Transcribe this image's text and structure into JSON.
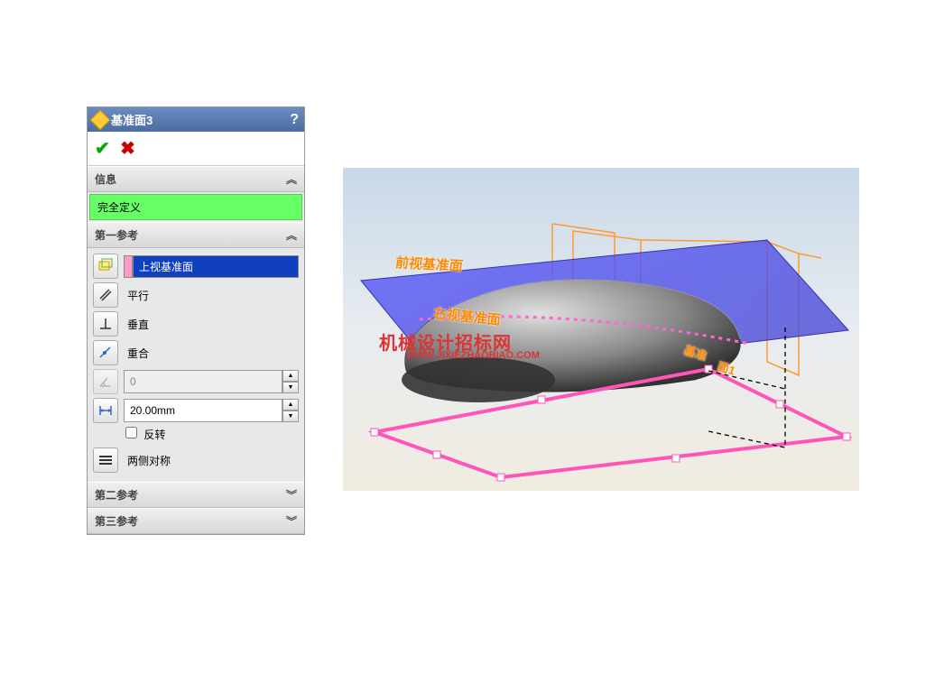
{
  "feature": {
    "title": "基准面3",
    "help": "?"
  },
  "actions": {
    "ok": "✔",
    "cancel": "✖"
  },
  "info_section": {
    "title": "信息"
  },
  "status": "完全定义",
  "ref1": {
    "title": "第一参考",
    "selected": "上视基准面",
    "parallel": "平行",
    "perpendicular": "垂直",
    "coincident": "重合",
    "angle_value": "0",
    "distance_value": "20.00mm",
    "flip_label": "反转",
    "flip_checked": false,
    "midplane_label": "两侧对称"
  },
  "ref2": {
    "title": "第二参考"
  },
  "ref3": {
    "title": "第三参考"
  },
  "viewport": {
    "front_plane": "前视基准面",
    "right_plane": "右视基准面",
    "plane1_a": "基准",
    "plane1_b": "面1",
    "watermark_main": "机械设计招标网",
    "watermark_sub": "WWW.JIXIEZHAOBIAO.COM"
  }
}
